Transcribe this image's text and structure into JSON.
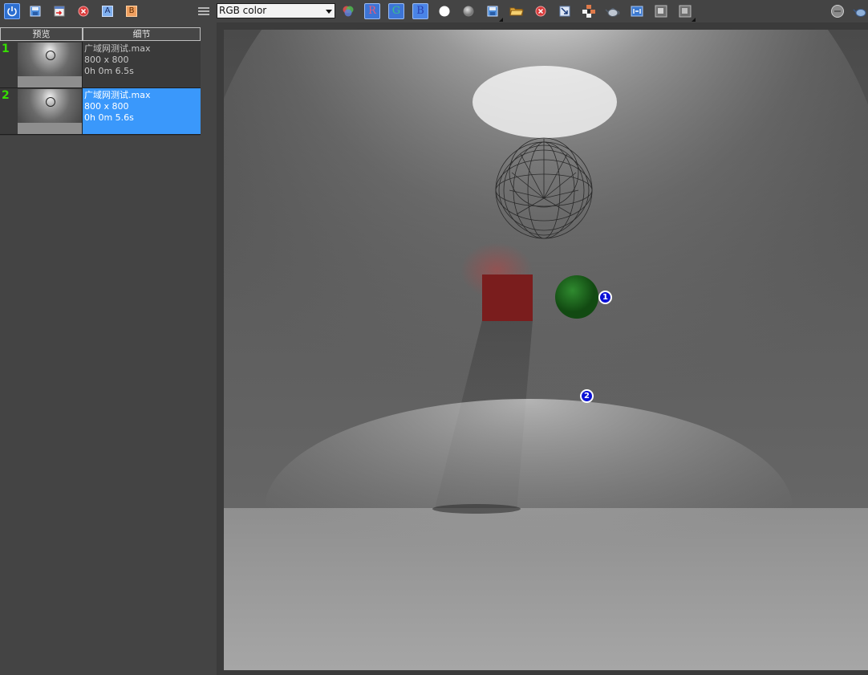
{
  "toolbar": {
    "channel_select": "RGB color",
    "red_channel": "R",
    "green_channel": "G",
    "blue_channel": "B",
    "compare_a": "A",
    "compare_b": "B",
    "icons": [
      "power-icon",
      "save-icon",
      "export-icon",
      "clear-icon",
      "compare-a-icon",
      "compare-b-icon",
      "menu-icon",
      "color-corrections-icon",
      "white-circle-icon",
      "gray-circle-icon",
      "save-image-icon",
      "open-folder-icon",
      "clear-image-icon",
      "region-render-icon",
      "track-mouse-icon",
      "teapot-icon",
      "lens-effects-icon",
      "stamp-icon",
      "layers-icon",
      "stop-icon",
      "teapot-render-icon"
    ]
  },
  "history": {
    "headers": {
      "preview": "预览",
      "details": "细节"
    },
    "rows": [
      {
        "index": "1",
        "file": "广域网测试.max",
        "resolution": "800 x 800",
        "time": "0h 0m 6.5s",
        "selected": false
      },
      {
        "index": "2",
        "file": "广域网测试.max",
        "resolution": "800 x 800",
        "time": "0h 0m 5.6s",
        "selected": true
      }
    ]
  },
  "viewport": {
    "markers": [
      "1",
      "2"
    ],
    "colors": {
      "wall": "#6f6f6f",
      "floor": "#8f8f8f",
      "red_box": "#7a1d1d",
      "green_sphere": "#1f6e1f",
      "marker": "#0a10d6"
    }
  }
}
